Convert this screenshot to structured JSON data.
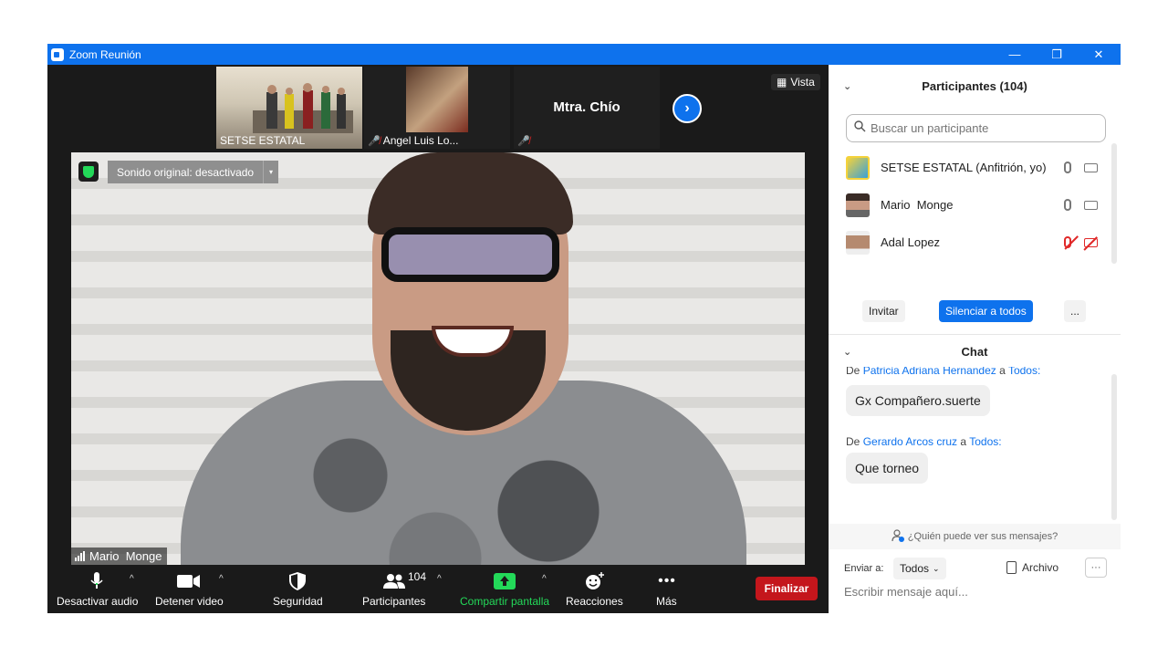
{
  "window": {
    "title": "Zoom Reunión",
    "min": "—",
    "max": "❐",
    "close": "✕"
  },
  "strip": {
    "thumbs": [
      {
        "name": "SETSE ESTATAL"
      },
      {
        "name": "Angel Luis Lo..."
      },
      {
        "name": "Mtra. Chío"
      }
    ],
    "next": "›",
    "vista_label": "Vista"
  },
  "main": {
    "sound_label": "Sonido original: desactivado",
    "caret": "▾",
    "speaker": "Mario  Monge"
  },
  "toolbar": {
    "audio": "Desactivar audio",
    "video": "Detener video",
    "security": "Seguridad",
    "participants": "Participantes",
    "participants_count": "104",
    "share": "Compartir pantalla",
    "reactions": "Reacciones",
    "more": "Más",
    "end": "Finalizar",
    "caret": "^"
  },
  "participants_panel": {
    "title": "Participantes (104)",
    "search_placeholder": "Buscar un participante",
    "items": [
      {
        "name": "SETSE ESTATAL (Anfitrión, yo)",
        "muted": false
      },
      {
        "name": "Mario  Monge",
        "muted": false
      },
      {
        "name": "Adal Lopez",
        "muted": true
      }
    ],
    "invite": "Invitar",
    "mute_all": "Silenciar a todos",
    "more": "..."
  },
  "chat": {
    "title": "Chat",
    "messages": [
      {
        "from_prefix": "De",
        "from": "Patricia Adriana Hernandez",
        "to_prefix": "a",
        "to": "Todos:",
        "text": "Gx Compañero.suerte"
      },
      {
        "from_prefix": "De",
        "from": "Gerardo Arcos cruz",
        "to_prefix": "a",
        "to": "Todos:",
        "text": "Que torneo"
      }
    ],
    "who_sees": "¿Quién puede ver sus mensajes?",
    "send_to_label": "Enviar a:",
    "send_to_value": "Todos",
    "file_label": "Archivo",
    "dots": "···",
    "input_placeholder": "Escribir mensaje aquí..."
  },
  "colors": {
    "accent": "#0e72ed",
    "end": "#c4161c",
    "share": "#23d959",
    "mute": "#e02828"
  }
}
